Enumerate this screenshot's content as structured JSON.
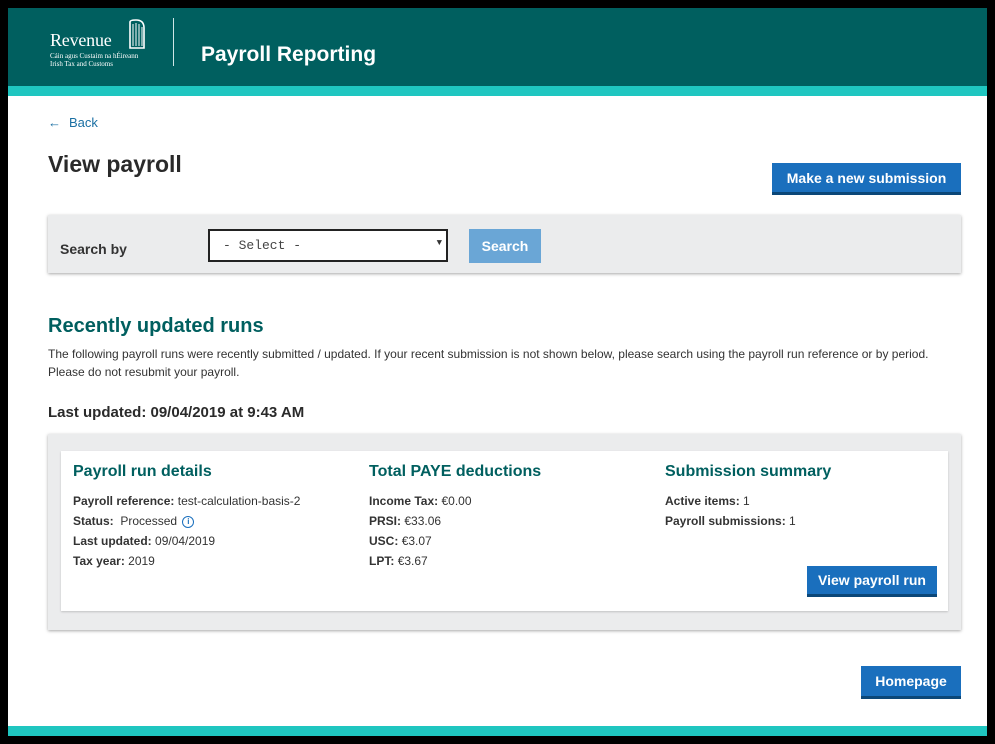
{
  "header": {
    "logo": {
      "name": "Revenue",
      "sub_line1": "Cáin agus Custaim na hÉireann",
      "sub_line2": "Irish Tax and Customs"
    },
    "app_title": "Payroll Reporting",
    "colors": {
      "header_bg": "#005f5f",
      "accent_stripe": "#1fc6c0"
    }
  },
  "nav": {
    "back_label": "Back",
    "back_icon": "arrow-left-icon"
  },
  "page": {
    "title": "View payroll"
  },
  "actions": {
    "new_submission_label": "Make a new submission",
    "homepage_label": "Homepage"
  },
  "search": {
    "label": "Search by",
    "select_value": "- Select -",
    "button_label": "Search"
  },
  "recent": {
    "title": "Recently updated runs",
    "intro": "The following payroll runs were recently submitted / updated. If your recent submission is not shown below, please search using the payroll run reference or by period. Please do not resubmit your payroll.",
    "last_updated": "Last updated: 09/04/2019 at 9:43 AM"
  },
  "run": {
    "details": {
      "title": "Payroll run details",
      "reference_label": "Payroll reference:",
      "reference_value": "test-calculation-basis-2",
      "status_label": "Status:",
      "status_value": "Processed",
      "last_updated_label": "Last updated:",
      "last_updated_value": "09/04/2019",
      "tax_year_label": "Tax year:",
      "tax_year_value": "2019"
    },
    "deductions": {
      "title": "Total PAYE deductions",
      "income_tax_label": "Income Tax:",
      "income_tax_value": "€0.00",
      "prsi_label": "PRSI:",
      "prsi_value": "€33.06",
      "usc_label": "USC:",
      "usc_value": "€3.07",
      "lpt_label": "LPT:",
      "lpt_value": "€3.67"
    },
    "summary": {
      "title": "Submission summary",
      "active_items_label": "Active items:",
      "active_items_value": "1",
      "payroll_submissions_label": "Payroll submissions:",
      "payroll_submissions_value": "1"
    },
    "view_button_label": "View payroll run"
  }
}
